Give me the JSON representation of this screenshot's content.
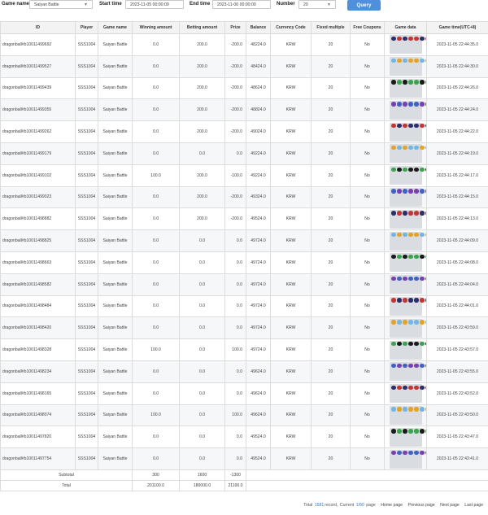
{
  "filters": {
    "game_name_label": "Game name",
    "game_name_value": "Saiyan Battle",
    "start_label": "Start time",
    "start_value": "2023-11-05 00:00:00",
    "end_label": "End time",
    "end_value": "2023-11-06 00:00:00",
    "number_label": "Number",
    "number_value": "20",
    "query_label": "Query"
  },
  "columns": [
    "ID",
    "Player",
    "Game name",
    "Winning amount",
    "Betting amount",
    "Prize",
    "Balance",
    "Currency Code",
    "Fixed multiple",
    "Free Coupons",
    "Game data",
    "Game time(UTC+8)"
  ],
  "rows": [
    {
      "id": "dragonball#b10011499692",
      "player": "SSS1004",
      "game": "Saiyan Battle",
      "win": "0.0",
      "bet": "200.0",
      "prize": "-200.0",
      "balance": "48224.0",
      "currency": "KRW",
      "multiple": "20",
      "coupons": "No",
      "time": "2023-11-05 22:44:35.0"
    },
    {
      "id": "dragonball#b10011499527",
      "player": "SSS1004",
      "game": "Saiyan Battle",
      "win": "0.0",
      "bet": "200.0",
      "prize": "-200.0",
      "balance": "48424.0",
      "currency": "KRW",
      "multiple": "20",
      "coupons": "No",
      "time": "2023-11-05 22:44:30.0"
    },
    {
      "id": "dragonball#b10011499439",
      "player": "SSS1004",
      "game": "Saiyan Battle",
      "win": "0.0",
      "bet": "200.0",
      "prize": "-200.0",
      "balance": "48624.0",
      "currency": "KRW",
      "multiple": "20",
      "coupons": "No",
      "time": "2023-11-05 22:44:26.0"
    },
    {
      "id": "dragonball#b10011499355",
      "player": "SSS1004",
      "game": "Saiyan Battle",
      "win": "0.0",
      "bet": "200.0",
      "prize": "-200.0",
      "balance": "48824.0",
      "currency": "KRW",
      "multiple": "20",
      "coupons": "No",
      "time": "2023-11-05 22:44:24.0"
    },
    {
      "id": "dragonball#b10011499262",
      "player": "SSS1004",
      "game": "Saiyan Battle",
      "win": "0.0",
      "bet": "200.0",
      "prize": "-200.0",
      "balance": "49024.0",
      "currency": "KRW",
      "multiple": "20",
      "coupons": "No",
      "time": "2023-11-05 22:44:22.0"
    },
    {
      "id": "dragonball#b10011499179",
      "player": "SSS1004",
      "game": "Saiyan Battle",
      "win": "0.0",
      "bet": "0.0",
      "prize": "0.0",
      "balance": "49224.0",
      "currency": "KRW",
      "multiple": "20",
      "coupons": "No",
      "time": "2023-11-05 22:44:19.0"
    },
    {
      "id": "dragonball#b10011499102",
      "player": "SSS1004",
      "game": "Saiyan Battle",
      "win": "100.0",
      "bet": "200.0",
      "prize": "-100.0",
      "balance": "49224.0",
      "currency": "KRW",
      "multiple": "20",
      "coupons": "No",
      "time": "2023-11-05 22:44:17.0"
    },
    {
      "id": "dragonball#b10011499023",
      "player": "SSS1004",
      "game": "Saiyan Battle",
      "win": "0.0",
      "bet": "200.0",
      "prize": "-200.0",
      "balance": "49324.0",
      "currency": "KRW",
      "multiple": "20",
      "coupons": "No",
      "time": "2023-11-05 22:44:15.0"
    },
    {
      "id": "dragonball#b10011498882",
      "player": "SSS1004",
      "game": "Saiyan Battle",
      "win": "0.0",
      "bet": "200.0",
      "prize": "-200.0",
      "balance": "49524.0",
      "currency": "KRW",
      "multiple": "20",
      "coupons": "No",
      "time": "2023-11-05 22:44:13.0"
    },
    {
      "id": "dragonball#b10011498825",
      "player": "SSS1004",
      "game": "Saiyan Battle",
      "win": "0.0",
      "bet": "0.0",
      "prize": "0.0",
      "balance": "49724.0",
      "currency": "KRW",
      "multiple": "20",
      "coupons": "No",
      "time": "2023-11-05 22:44:09.0"
    },
    {
      "id": "dragonball#b10011498663",
      "player": "SSS1004",
      "game": "Saiyan Battle",
      "win": "0.0",
      "bet": "0.0",
      "prize": "0.0",
      "balance": "49724.0",
      "currency": "KRW",
      "multiple": "20",
      "coupons": "No",
      "time": "2023-11-05 22:44:08.0"
    },
    {
      "id": "dragonball#b10011498582",
      "player": "SSS1004",
      "game": "Saiyan Battle",
      "win": "0.0",
      "bet": "0.0",
      "prize": "0.0",
      "balance": "49724.0",
      "currency": "KRW",
      "multiple": "20",
      "coupons": "No",
      "time": "2023-11-05 22:44:04.0"
    },
    {
      "id": "dragonball#b10011498484",
      "player": "SSS1004",
      "game": "Saiyan Battle",
      "win": "0.0",
      "bet": "0.0",
      "prize": "0.0",
      "balance": "49724.0",
      "currency": "KRW",
      "multiple": "20",
      "coupons": "No",
      "time": "2023-11-05 22:44:01.0"
    },
    {
      "id": "dragonball#b10011498420",
      "player": "SSS1004",
      "game": "Saiyan Battle",
      "win": "0.0",
      "bet": "0.0",
      "prize": "0.0",
      "balance": "49724.0",
      "currency": "KRW",
      "multiple": "20",
      "coupons": "No",
      "time": "2023-11-05 22:43:59.0"
    },
    {
      "id": "dragonball#b10011498328",
      "player": "SSS1004",
      "game": "Saiyan Battle",
      "win": "100.0",
      "bet": "0.0",
      "prize": "100.0",
      "balance": "49724.0",
      "currency": "KRW",
      "multiple": "20",
      "coupons": "No",
      "time": "2023-11-05 22:43:57.0"
    },
    {
      "id": "dragonball#b10011498234",
      "player": "SSS1004",
      "game": "Saiyan Battle",
      "win": "0.0",
      "bet": "0.0",
      "prize": "0.0",
      "balance": "49624.0",
      "currency": "KRW",
      "multiple": "20",
      "coupons": "No",
      "time": "2023-11-05 22:43:55.0"
    },
    {
      "id": "dragonball#b10011498165",
      "player": "SSS1004",
      "game": "Saiyan Battle",
      "win": "0.0",
      "bet": "0.0",
      "prize": "0.0",
      "balance": "49624.0",
      "currency": "KRW",
      "multiple": "20",
      "coupons": "No",
      "time": "2023-11-05 22:43:52.0"
    },
    {
      "id": "dragonball#b10011498074",
      "player": "SSS1004",
      "game": "Saiyan Battle",
      "win": "100.0",
      "bet": "0.0",
      "prize": "100.0",
      "balance": "49624.0",
      "currency": "KRW",
      "multiple": "20",
      "coupons": "No",
      "time": "2023-11-05 22:43:50.0"
    },
    {
      "id": "dragonball#b10011497820",
      "player": "SSS1004",
      "game": "Saiyan Battle",
      "win": "0.0",
      "bet": "0.0",
      "prize": "0.0",
      "balance": "49524.0",
      "currency": "KRW",
      "multiple": "20",
      "coupons": "No",
      "time": "2023-11-05 22:43:47.0"
    },
    {
      "id": "dragonball#b10011497754",
      "player": "SSS1004",
      "game": "Saiyan Battle",
      "win": "0.0",
      "bet": "0.0",
      "prize": "0.0",
      "balance": "49524.0",
      "currency": "KRW",
      "multiple": "20",
      "coupons": "No",
      "time": "2023-11-05 22:43:41.0"
    }
  ],
  "subtotal": {
    "label": "Subtotal",
    "win": "300",
    "bet": "1600",
    "prize": "-1300"
  },
  "total": {
    "label": "Total",
    "win": "201100.0",
    "bet": "180000.0",
    "prize": "21100.0"
  },
  "pager": {
    "total_prefix": "Total",
    "total_count": "1581",
    "total_suffix": "record,",
    "current_prefix": "Current",
    "current_page": "1/80",
    "current_suffix": "page",
    "home": "Home page",
    "prev": "Previous page",
    "next": "Next page",
    "last": "Last page"
  },
  "colors": {
    "accent": "#4f8fdd",
    "header_bg": "#f3f3f3",
    "row_alt": "#f6f7f8",
    "game_data_bg": "#d9dde2",
    "symbols": [
      "#2b2f6e",
      "#3e63c8",
      "#37a64a",
      "#e8a21c",
      "#c9342e",
      "#7a3fb3",
      "#1b1b1b",
      "#6fb7e8"
    ]
  }
}
